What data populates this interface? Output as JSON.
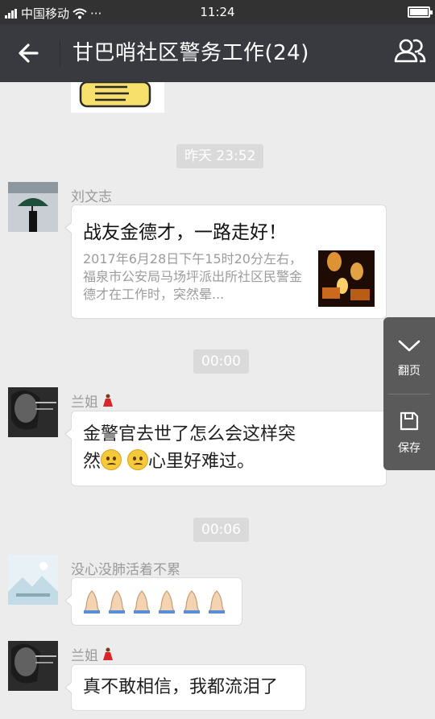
{
  "status_bar": {
    "carrier": "中国移动",
    "time": "11:24",
    "extra": "···"
  },
  "header": {
    "title": "甘巴哨社区警务工作(24)",
    "back_icon": "arrow-left-icon",
    "members_icon": "group-members-icon"
  },
  "messages": {
    "ts1": "昨天 23:52",
    "msg1": {
      "sender": "刘文志",
      "link_title": "战友金德才，一路走好！",
      "link_desc": "2017年6月28日下午15时20分左右，福泉市公安局马场坪派出所社区民警金德才在工作时，突然晕..."
    },
    "ts2": "00:00",
    "msg2": {
      "sender": "兰姐",
      "text_a": "金警官去世了怎么会这样突",
      "text_b": "然",
      "text_c": "心里好难过。"
    },
    "ts3": "00:06",
    "msg3": {
      "sender": "没心没肺活着不累",
      "emoji": "folded-hands-icon"
    },
    "msg4": {
      "sender": "兰姐",
      "text": "真不敢相信，我都流泪了"
    }
  },
  "side_panel": {
    "page_label": "翻页",
    "save_label": "保存"
  },
  "colors": {
    "titlebar": "#393a3f",
    "status": "#323232",
    "background": "#ececec"
  }
}
